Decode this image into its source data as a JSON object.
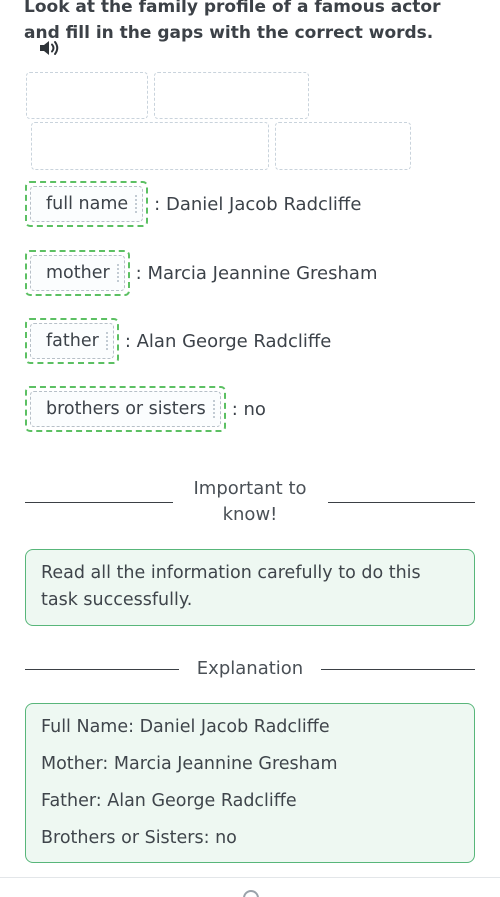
{
  "instruction": {
    "line1": "Look at the family profile of a famous actor",
    "line2": "and fill in the gaps with the correct words."
  },
  "icons": {
    "audio": "speaker-icon"
  },
  "rows": [
    {
      "chip": "full name",
      "value": ": Daniel Jacob Radcliffe"
    },
    {
      "chip": "mother",
      "value": ": Marcia Jeannine Gresham"
    },
    {
      "chip": "father",
      "value": ": Alan George Radcliffe"
    },
    {
      "chip": "brothers or sisters",
      "value": ": no"
    }
  ],
  "important": {
    "heading": "Important to know!",
    "text": "Read all the information carefully to do this task successfully."
  },
  "explanation": {
    "heading": "Explanation",
    "lines": [
      "Full Name: Daniel Jacob Radcliffe",
      "Mother: Marcia Jeannine Gresham",
      "Father: Alan George Radcliffe",
      "Brothers or Sisters: no"
    ]
  },
  "colors": {
    "accent_green": "#5cc063",
    "box_border": "#58b67a",
    "box_bg": "#eef8f2"
  }
}
